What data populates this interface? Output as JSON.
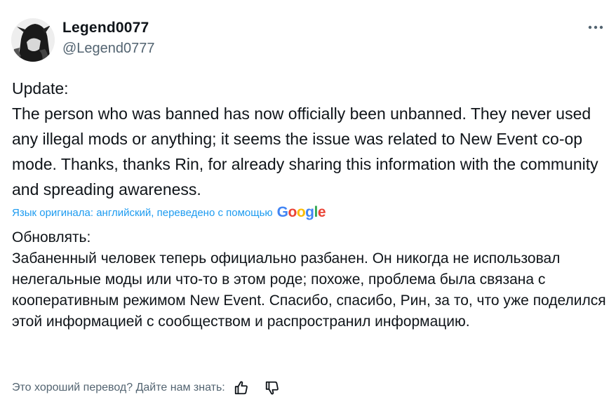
{
  "tweet": {
    "author": {
      "display_name": "Legend0077",
      "handle": "@Legend0777",
      "avatar_icon": "anime-character-avatar"
    },
    "more_icon": "more-horizontal-icon",
    "original_text": "Update:\nThe person who was banned has now officially been unbanned. They never used any illegal mods or anything; it seems the issue was related to New Event co-op mode. Thanks, thanks Rin, for already sharing this information with the community and spreading awareness.",
    "translation": {
      "source_label": "Язык оригинала: английский, переведено с помощью",
      "provider": "Google",
      "provider_letters": [
        {
          "ch": "G",
          "color": "#4285F4"
        },
        {
          "ch": "o",
          "color": "#EA4335"
        },
        {
          "ch": "o",
          "color": "#FBBC05"
        },
        {
          "ch": "g",
          "color": "#4285F4"
        },
        {
          "ch": "l",
          "color": "#34A853"
        },
        {
          "ch": "e",
          "color": "#EA4335"
        }
      ],
      "text": "Обновлять:\nЗабаненный человек теперь официально разбанен. Он никогда не использовал нелегальные моды или что-то в этом роде; похоже, проблема была связана с кооперативным режимом New Event. Спасибо, спасибо, Рин, за то, что уже поделился этой информацией с сообществом и распространил информацию."
    },
    "feedback": {
      "prompt": "Это хороший перевод? Дайте нам знать:",
      "thumbs_up_icon": "thumbs-up-icon",
      "thumbs_down_icon": "thumbs-down-icon"
    }
  },
  "colors": {
    "text_primary": "#0f1419",
    "text_secondary": "#536471",
    "link": "#1d9bf0"
  }
}
